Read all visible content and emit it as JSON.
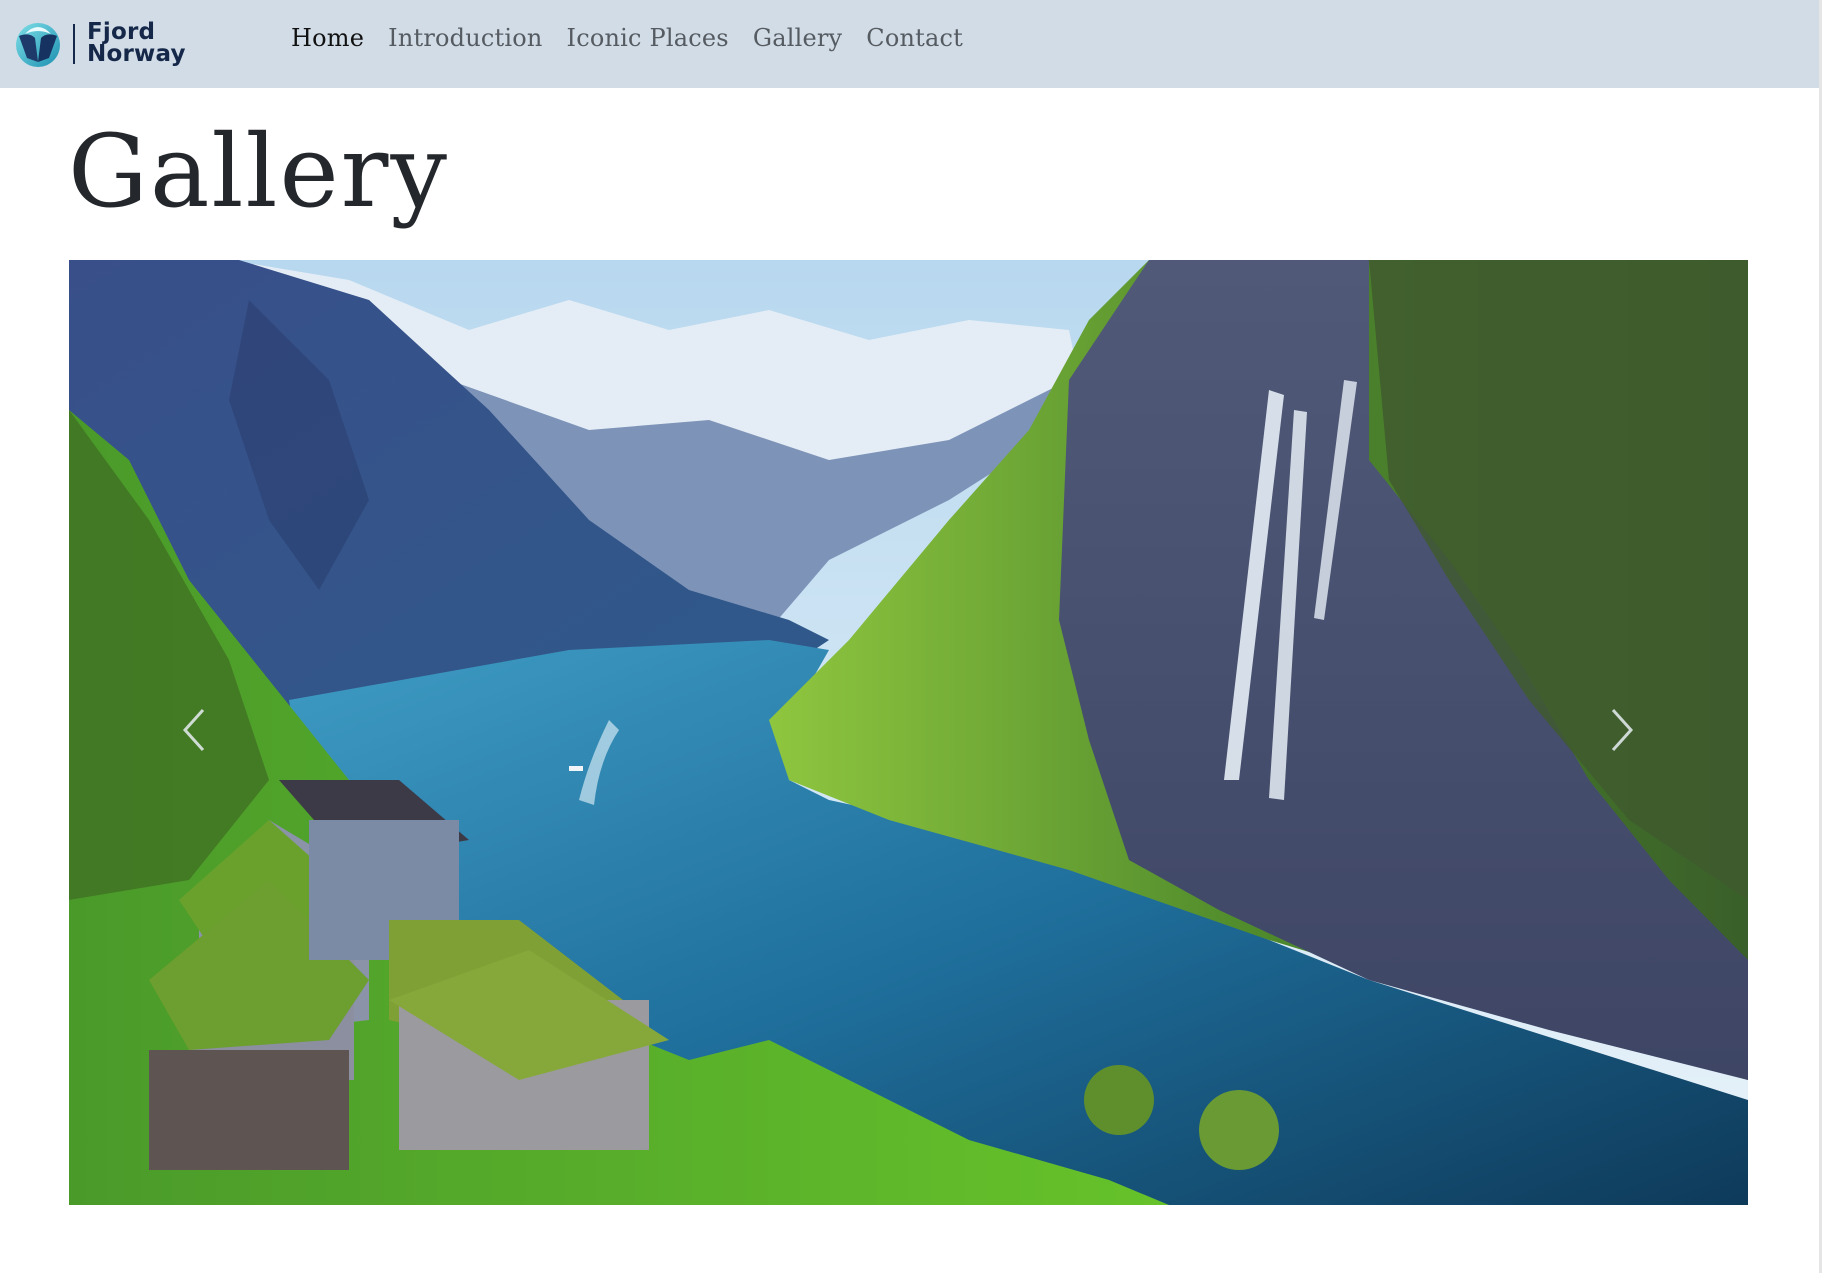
{
  "brand": {
    "name_line1": "Fjord",
    "name_line2": "Norway",
    "logo_icon": "fjord-norway-logo-icon",
    "colors": {
      "navy": "#16284a",
      "teal": "#2bb6c9"
    }
  },
  "nav": {
    "links": [
      {
        "label": "Home",
        "active": true
      },
      {
        "label": "Introduction"
      },
      {
        "label": "Iconic Places"
      },
      {
        "label": "Gallery"
      },
      {
        "label": "Contact"
      }
    ],
    "background": "#d1dce6"
  },
  "page": {
    "title": "Gallery"
  },
  "carousel": {
    "prev_icon": "chevron-left-icon",
    "next_icon": "chevron-right-icon",
    "image_subject": "fjord-landscape"
  }
}
